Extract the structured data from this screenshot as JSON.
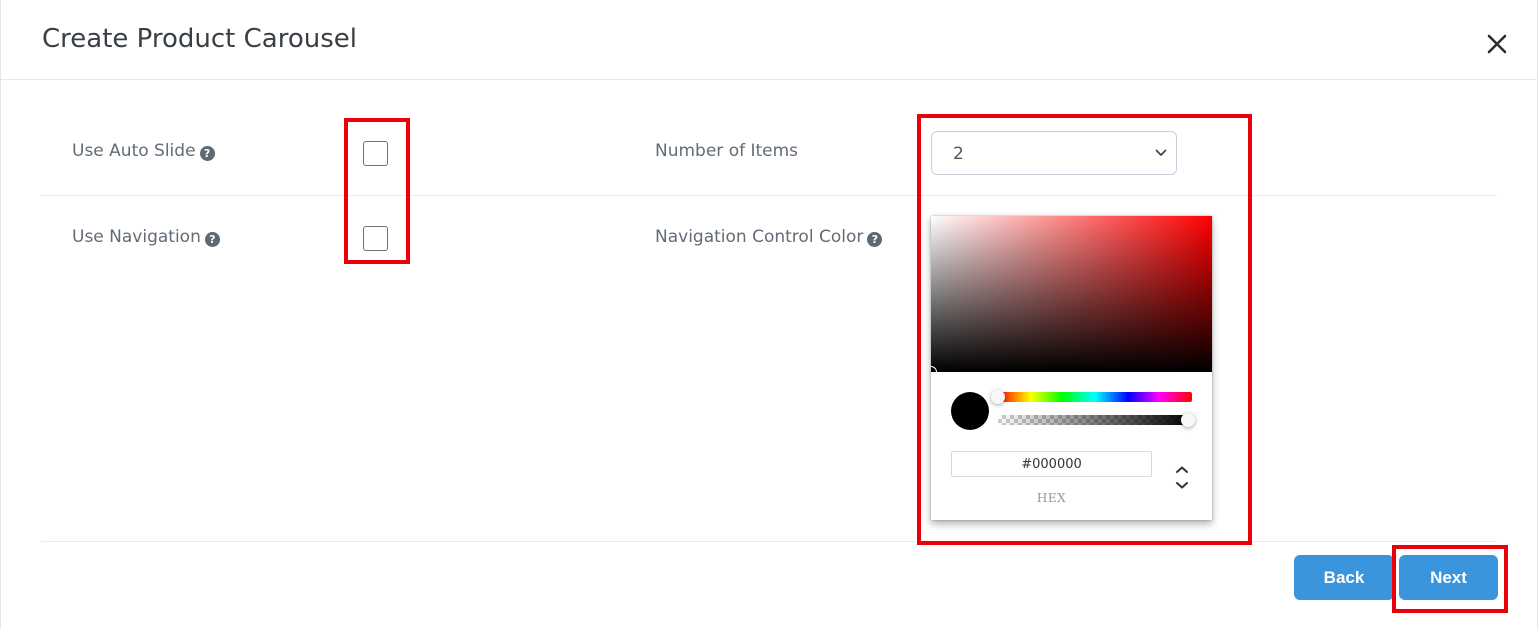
{
  "modal": {
    "title": "Create Product Carousel",
    "close_icon": "close-icon"
  },
  "form": {
    "auto_slide": {
      "label": "Use Auto Slide",
      "checked": false,
      "help_icon": "question-circle-icon"
    },
    "navigation": {
      "label": "Use Navigation",
      "checked": false,
      "help_icon": "question-circle-icon"
    },
    "number_of_items": {
      "label": "Number of Items",
      "selected": "2",
      "chevron_icon": "chevron-down-icon"
    },
    "nav_control_color": {
      "label": "Navigation Control Color",
      "help_icon": "question-circle-icon"
    }
  },
  "color_picker": {
    "hue_color": "#ff0000",
    "selected_color": "#000000",
    "hex_value": "#000000",
    "mode_label": "HEX",
    "mode_toggle_icon": "up-down-chevron-icon"
  },
  "footer": {
    "back_label": "Back",
    "next_label": "Next"
  },
  "colors": {
    "accent": "#3a95dd",
    "highlight": "#e8000b",
    "text": "#626c77"
  }
}
